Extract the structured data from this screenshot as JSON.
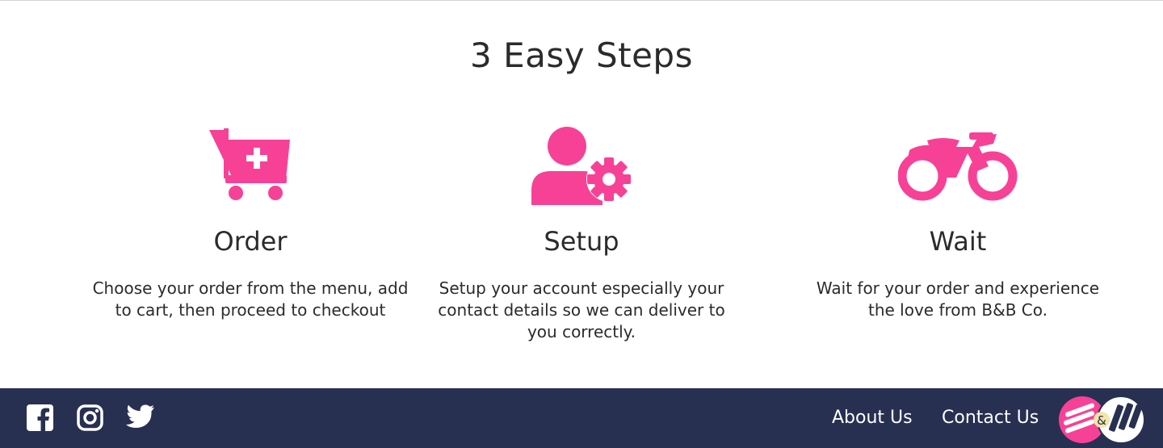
{
  "section": {
    "title": "3 Easy Steps"
  },
  "steps": [
    {
      "icon": "cart-plus-icon",
      "title": "Order",
      "description": "Choose your order from the menu, add to cart, then proceed to checkout"
    },
    {
      "icon": "user-gear-icon",
      "title": "Setup",
      "description": "Setup your account especially your contact details so we can deliver to you correctly."
    },
    {
      "icon": "motorcycle-icon",
      "title": "Wait",
      "description": "Wait for your order and experience the love from B&B Co."
    }
  ],
  "footer": {
    "social": [
      "facebook-icon",
      "instagram-icon",
      "twitter-icon"
    ],
    "links": {
      "about": "About Us",
      "contact": "Contact Us"
    },
    "logo": "bb-co-logo"
  },
  "colors": {
    "accent": "#f74197",
    "footer_bg": "#283052",
    "text": "#2b2b2b"
  }
}
